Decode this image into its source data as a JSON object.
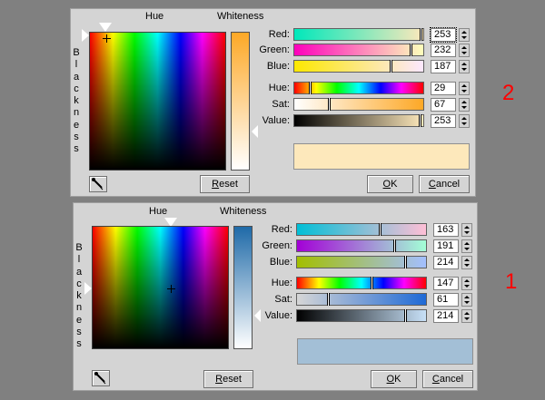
{
  "annotations": {
    "top_number": "2",
    "bottom_number": "1"
  },
  "dialogs": [
    {
      "id": "top",
      "hue_label": "Hue",
      "whiteness_label": "Whiteness",
      "blackness_letters": [
        "B",
        "l",
        "a",
        "c",
        "k",
        "n",
        "e",
        "s",
        "s"
      ],
      "sliders": {
        "red": {
          "label": "Red:",
          "value": "253"
        },
        "green": {
          "label": "Green:",
          "value": "232"
        },
        "blue": {
          "label": "Blue:",
          "value": "187"
        },
        "hue": {
          "label": "Hue:",
          "value": "29"
        },
        "sat": {
          "label": "Sat:",
          "value": "67"
        },
        "value": {
          "label": "Value:",
          "value": "253"
        }
      },
      "swatch_color": "#fde8bb",
      "whiteness_color": "#fda826",
      "buttons": {
        "reset_prefix": "R",
        "reset_rest": "eset",
        "ok_prefix": "O",
        "ok_rest": "K",
        "cancel_prefix": "C",
        "cancel_rest": "ancel"
      },
      "icons": {
        "eyedropper": "eyedropper-icon"
      }
    },
    {
      "id": "bottom",
      "hue_label": "Hue",
      "whiteness_label": "Whiteness",
      "blackness_letters": [
        "B",
        "l",
        "a",
        "c",
        "k",
        "n",
        "e",
        "s",
        "s"
      ],
      "sliders": {
        "red": {
          "label": "Red:",
          "value": "163"
        },
        "green": {
          "label": "Green:",
          "value": "191"
        },
        "blue": {
          "label": "Blue:",
          "value": "214"
        },
        "hue": {
          "label": "Hue:",
          "value": "147"
        },
        "sat": {
          "label": "Sat:",
          "value": "61"
        },
        "value": {
          "label": "Value:",
          "value": "214"
        }
      },
      "swatch_color": "#a3bfd6",
      "whiteness_color": "#1f6aa8",
      "buttons": {
        "reset_prefix": "R",
        "reset_rest": "eset",
        "ok_prefix": "O",
        "ok_rest": "K",
        "cancel_prefix": "C",
        "cancel_rest": "ancel"
      },
      "icons": {
        "eyedropper": "eyedropper-icon"
      }
    }
  ]
}
